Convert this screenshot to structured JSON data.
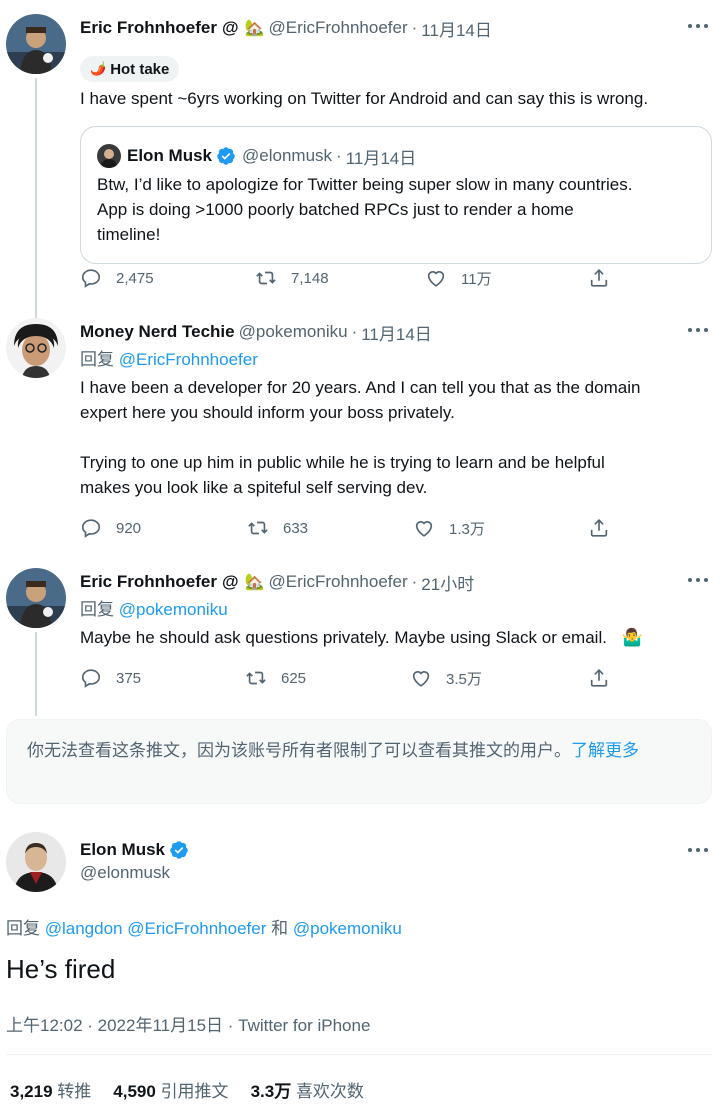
{
  "tweet1": {
    "name": "Eric Frohnhoefer",
    "name_suffix": "@",
    "house_emoji": "🏡",
    "handle": "@EricFrohnhoefer",
    "sep": "·",
    "date": "11月14日",
    "badge_emoji": "🌶️",
    "badge": "Hot take",
    "text": "I have spent ~6yrs working on Twitter for Android and can say this is wrong.",
    "quote": {
      "name": "Elon Musk",
      "handle": "@elonmusk",
      "sep": "·",
      "date": "11月14日",
      "line1": "Btw, I’d like to apologize for Twitter being super slow in many countries.",
      "line2": "App is doing >1000 poorly batched RPCs just to render a home",
      "line3": "timeline!"
    },
    "replies": "2,475",
    "retweets": "7,148",
    "likes": "11万"
  },
  "tweet2": {
    "name": "Money Nerd Techie",
    "handle": "@pokemoniku",
    "sep": "·",
    "date": "11月14日",
    "reply_prefix": "回复",
    "reply_to": "@EricFrohnhoefer",
    "line1": "I have been a developer for 20 years.  And I can tell you that as the domain",
    "line2": "expert here you should inform your boss privately.",
    "line3": "Trying to one up him in public while he is trying to learn and be helpful",
    "line4": "makes you look like a spiteful self serving dev.",
    "replies": "920",
    "retweets": "633",
    "likes": "1.3万"
  },
  "tweet3": {
    "name": "Eric Frohnhoefer",
    "name_suffix": "@",
    "house_emoji": "🏡",
    "handle": "@EricFrohnhoefer",
    "sep": "·",
    "date": "21小时",
    "reply_prefix": "回复",
    "reply_to": "@pokemoniku",
    "text": "Maybe he should ask questions privately. Maybe using Slack or email.",
    "emoji": "🤷‍♂️",
    "replies": "375",
    "retweets": "625",
    "likes": "3.5万"
  },
  "restricted": {
    "text": "你无法查看这条推文，因为该账号所有者限制了可以查看其推文的用户。",
    "link": "了解更多"
  },
  "main": {
    "name": "Elon Musk",
    "handle": "@elonmusk",
    "reply_prefix": "回复",
    "reply_to_1": "@langdon",
    "reply_to_2": "@EricFrohnhoefer",
    "and": "和",
    "reply_to_3": "@pokemoniku",
    "text": "He’s fired",
    "meta": "上午12:02 · 2022年11月15日 · Twitter for iPhone",
    "retweets_count": "3,219",
    "retweets_label": "转推",
    "quotes_count": "4,590",
    "quotes_label": "引用推文",
    "likes_count": "3.3万",
    "likes_label": "喜欢次数"
  },
  "colors": {
    "link": "#1d9bf0",
    "muted": "#536471",
    "verified": "#1d9bf0"
  }
}
